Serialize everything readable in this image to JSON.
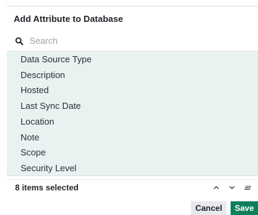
{
  "dialog": {
    "title": "Add Attribute to Database"
  },
  "search": {
    "placeholder": "Search",
    "value": ""
  },
  "attributes": [
    {
      "label": "Data Source Type"
    },
    {
      "label": "Description"
    },
    {
      "label": "Hosted"
    },
    {
      "label": "Last Sync Date"
    },
    {
      "label": "Location"
    },
    {
      "label": "Note"
    },
    {
      "label": "Scope"
    },
    {
      "label": "Security Level"
    }
  ],
  "footer": {
    "selected_text": "8 items selected",
    "icons": [
      "chevron-up-icon",
      "chevron-down-icon",
      "filter-lines-icon"
    ]
  },
  "actions": {
    "cancel_label": "Cancel",
    "save_label": "Save"
  },
  "colors": {
    "selected_row_bg": "#e8f2f0",
    "primary": "#0e7f5c",
    "secondary_button": "#e7e9ec"
  }
}
